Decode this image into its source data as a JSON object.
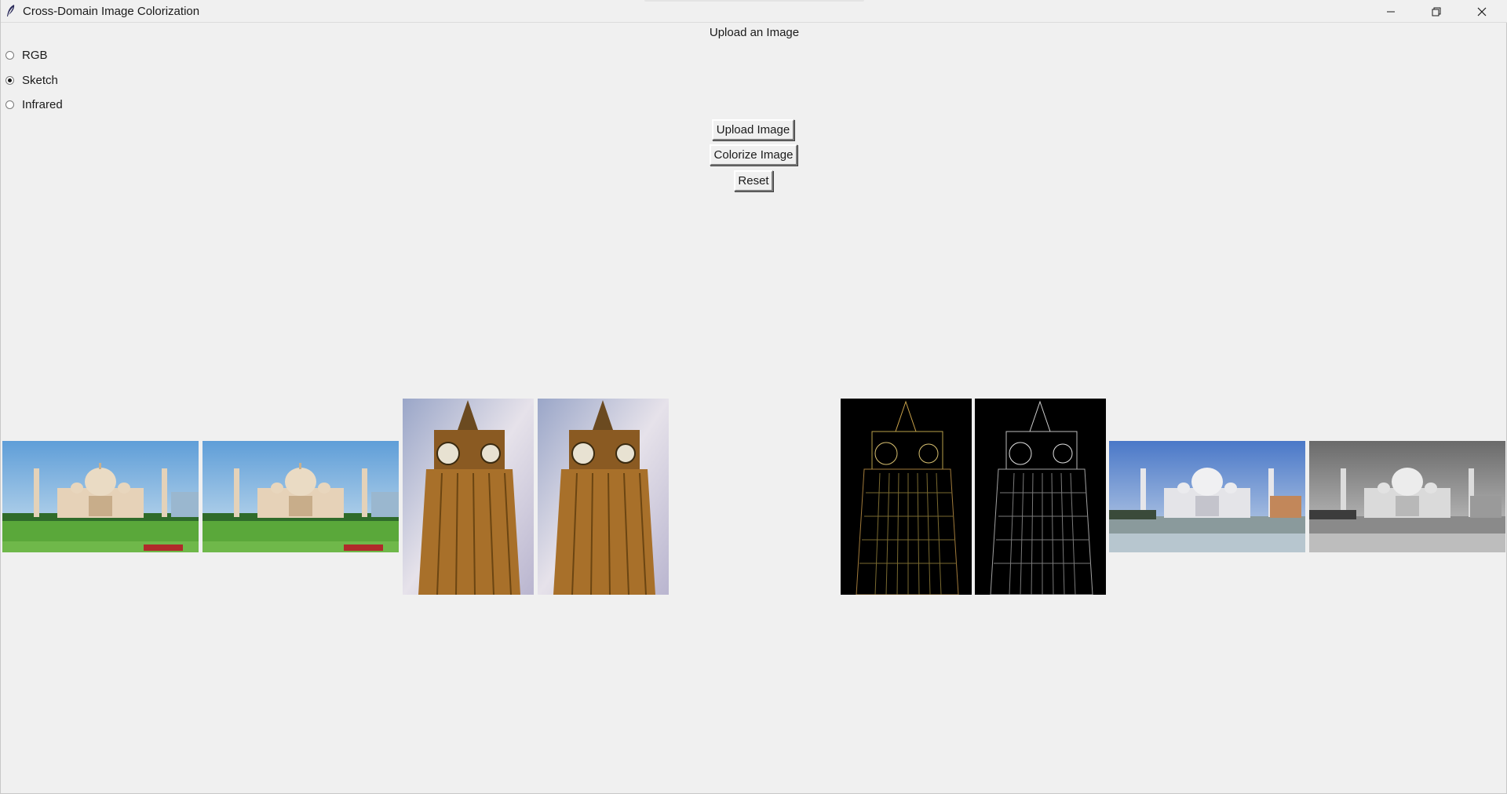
{
  "window": {
    "title": "Cross-Domain Image Colorization",
    "icon": "feather-icon",
    "controls": [
      "minimize-icon",
      "restore-icon",
      "close-icon"
    ]
  },
  "main": {
    "heading": "Upload an Image",
    "domain_options": [
      {
        "label": "RGB",
        "checked": false
      },
      {
        "label": "Sketch",
        "checked": true
      },
      {
        "label": "Infrared",
        "checked": false
      }
    ],
    "buttons": {
      "upload": "Upload Image",
      "colorize": "Colorize Image",
      "reset": "Reset"
    },
    "images": [
      {
        "name": "taj-mahal-color-image",
        "style": "color"
      },
      {
        "name": "taj-mahal-color-image",
        "style": "color"
      },
      {
        "name": "big-ben-color-image",
        "style": "color"
      },
      {
        "name": "big-ben-color-image",
        "style": "color"
      },
      {
        "name": "big-ben-sketch-color-image",
        "style": "sketch-color"
      },
      {
        "name": "big-ben-sketch-gray-image",
        "style": "sketch-gray"
      },
      {
        "name": "taj-mahal-colorized-image",
        "style": "colorized"
      },
      {
        "name": "taj-mahal-grayscale-image",
        "style": "grayscale"
      }
    ]
  },
  "colors": {
    "background": "#f0f0f0",
    "text": "#1a1a1a",
    "sky_blue": "#7fb4e0",
    "grass_green": "#5aa83a",
    "clock_brown": "#a8702a"
  }
}
